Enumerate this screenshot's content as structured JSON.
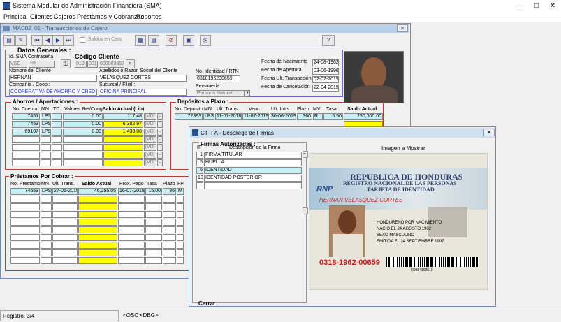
{
  "app": {
    "title": "Sistema Modular de Administración Financiera (SMA)"
  },
  "menu": [
    "Principal",
    "Clientes",
    "Cajeros",
    "Préstamos y Cobranzas",
    "Reportes"
  ],
  "child": {
    "title": "MAC02_01 - Transacciones de Cajero",
    "saldos_cero": "Saldos en Cero",
    "help": "?"
  },
  "general": {
    "title": "Datos Generales :",
    "lbl_id": "Id. SMA",
    "lbl_pwd": "Contraseña",
    "lbl_codigo": "Código Cliente",
    "id_sma": "VSC",
    "password": "***",
    "cod1": "010",
    "cod2": "001",
    "cod3": "000003857",
    "lbl_nombre": "Nombre del Cliente",
    "lbl_apellidos": "Apellidos o Razon Social del Cliente",
    "nombre": "HERNAN",
    "apellidos": "VELASQUEZ CORTES",
    "lbl_id_rtn": "No. Identidad / RTN",
    "id_rtn": "0318196200659",
    "lbl_compania": "Compañía / Coop.:",
    "lbl_sucursal": "Sucursal / Filial :",
    "lbl_personeria": "Personería",
    "compania": "COOPERATIVA DE AHORRO Y CRÉDITO",
    "sucursal": "OFICINA PRINCIPAL",
    "personeria": "Persona Natural",
    "lbl_nac": "Fecha de Nacimiento",
    "lbl_ape": "Fecha de Apertura",
    "lbl_ult": "Fecha Ult. Transacción",
    "lbl_can": "Fecha de Cancelación",
    "nac": "24-08-1962",
    "ape": "03-06-1996",
    "ult": "02-07-2019",
    "can": "22-04-2015"
  },
  "ahorros": {
    "title": "Ahorros / Aportaciones :",
    "cols": [
      "No. Cuenta",
      "MN",
      "TD",
      "Valores Ret/Cong",
      "Saldo Actual (Lib)"
    ],
    "rows": [
      {
        "cuenta": "7451",
        "mn": "LPS",
        "td": "",
        "ret": "0.00",
        "saldo": "117.48",
        "v": "[VD]"
      },
      {
        "cuenta": "7453",
        "mn": "LPS",
        "td": "",
        "ret": "0.00",
        "saldo": "6,382.97",
        "v": "[VD]"
      },
      {
        "cuenta": "69107",
        "mn": "LPS",
        "td": "",
        "ret": "0.00",
        "saldo": "1,433.08",
        "v": "[VD]"
      },
      {
        "cuenta": "",
        "mn": "",
        "td": "",
        "ret": "",
        "saldo": "",
        "v": "[VD]"
      },
      {
        "cuenta": "",
        "mn": "",
        "td": "",
        "ret": "",
        "saldo": "",
        "v": "[VD]"
      },
      {
        "cuenta": "",
        "mn": "",
        "td": "",
        "ret": "",
        "saldo": "",
        "v": "[VD]"
      },
      {
        "cuenta": "",
        "mn": "",
        "td": "",
        "ret": "",
        "saldo": "",
        "v": "[VD]"
      }
    ]
  },
  "depositos": {
    "title": "Depósitos a Plazo :",
    "cols": [
      "No. Deposito",
      "MN",
      "Ult. Trans.",
      "Venc.",
      "Ult. Intrs.",
      "Plazo",
      "MV",
      "Tasa",
      "Saldo Actual"
    ],
    "row": {
      "dep": "72393",
      "mn": "LPS",
      "ult": "11-07-2018",
      "venc": "11-07-2019",
      "intrs": "30-06-2019",
      "plazo": "360",
      "mv": "R",
      "tasa": "5.50",
      "saldo": "250,000.00"
    }
  },
  "prestamos": {
    "title": "Préstamos Por Cobrar :",
    "cols": [
      "No. Prestamo",
      "MN",
      "Ult. Trans.",
      "Saldo Actual",
      "Prox. Pago",
      "Tasa",
      "Plazo",
      "FP"
    ],
    "row": {
      "no": "74653",
      "mn": "LPS",
      "ult": "27-06-2019",
      "saldo": "46,255.05",
      "prox": "16-07-2019",
      "tasa": "15.00",
      "plazo": "36",
      "fp": "M"
    }
  },
  "dialog": {
    "title": "CT_FA  - Despliege de Firmas",
    "firmas_title": "Firmas Autorizadas :",
    "col_if": "IF",
    "col_desc": "Descripción de la Firma",
    "img_title": "Imagen a Mostrar",
    "rows": [
      {
        "n": "1",
        "d": "FIRMA TITULAR"
      },
      {
        "n": "5",
        "d": "HUELLA"
      },
      {
        "n": "6",
        "d": "IDENTIDAD"
      },
      {
        "n": "10",
        "d": "IDENTIDAD POSTERIOR"
      }
    ],
    "close": "Cerrar"
  },
  "card": {
    "l1": "REPUBLICA DE HONDURAS",
    "l2": "REGISTRO NACIONAL DE LAS PERSONAS",
    "l3": "TARJETA DE IDENTIDAD",
    "rnp": "RNP",
    "name": "HERNAN VELASQUEZ CORTES",
    "f1": "HONDURENO POR NACIMIENTO",
    "f2": "NACIO EL 24 AGOSTO 1962",
    "f3": "SEXO MASCULINO",
    "f4": "EMITIDA EL 24 SEPTIEMBRE 1997",
    "num": "0318-1962-00659",
    "bc": "00984362519"
  },
  "status": {
    "registro": "Registro: 3/4",
    "osc": "<OSC>",
    "dbg": "<DBG>"
  },
  "colors": {
    "cyan": "#c8f0f4",
    "yellow": "#ffff00",
    "frame": "#b23c3c",
    "title": "#b9d1ea"
  }
}
